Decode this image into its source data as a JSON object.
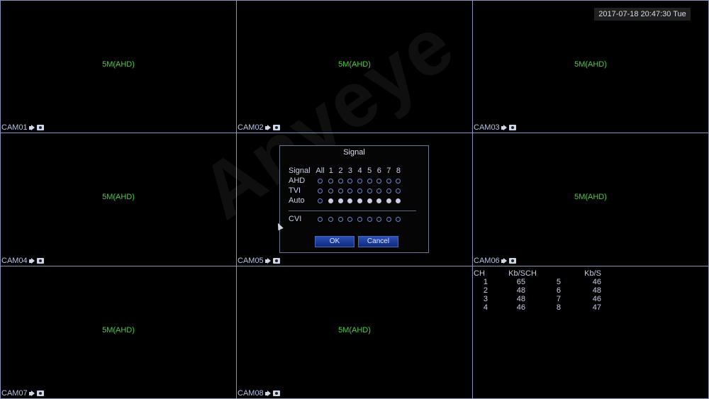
{
  "datetime": "2017-07-18 20:47:30 Tue",
  "watermark": "Anveye",
  "cameras": [
    {
      "name": "CAM01",
      "resolution": "5M(AHD)"
    },
    {
      "name": "CAM02",
      "resolution": "5M(AHD)"
    },
    {
      "name": "CAM03",
      "resolution": "5M(AHD)"
    },
    {
      "name": "CAM04",
      "resolution": "5M(AHD)"
    },
    {
      "name": "CAM05",
      "resolution": ""
    },
    {
      "name": "CAM06",
      "resolution": "5M(AHD)"
    },
    {
      "name": "CAM07",
      "resolution": "5M(AHD)"
    },
    {
      "name": "CAM08",
      "resolution": "5M(AHD)"
    }
  ],
  "stats": {
    "headers": [
      "CH",
      "Kb/S",
      "CH",
      "Kb/S"
    ],
    "rows": [
      [
        "1",
        "65",
        "5",
        "46"
      ],
      [
        "2",
        "48",
        "6",
        "48"
      ],
      [
        "3",
        "48",
        "7",
        "46"
      ],
      [
        "4",
        "46",
        "8",
        "47"
      ]
    ]
  },
  "dialog": {
    "title": "Signal",
    "header_label": "Signal",
    "all_label": "All",
    "channels": [
      "1",
      "2",
      "3",
      "4",
      "5",
      "6",
      "7",
      "8"
    ],
    "rows": [
      {
        "label": "AHD",
        "all": false,
        "values": [
          false,
          false,
          false,
          false,
          false,
          false,
          false,
          false
        ]
      },
      {
        "label": "TVI",
        "all": false,
        "values": [
          false,
          false,
          false,
          false,
          false,
          false,
          false,
          false
        ]
      },
      {
        "label": "Auto",
        "all": false,
        "values": [
          true,
          true,
          true,
          true,
          true,
          true,
          true,
          true
        ]
      }
    ],
    "cvi": {
      "label": "CVI",
      "all": false,
      "values": [
        false,
        false,
        false,
        false,
        false,
        false,
        false,
        false
      ]
    },
    "ok_label": "OK",
    "cancel_label": "Cancel"
  }
}
